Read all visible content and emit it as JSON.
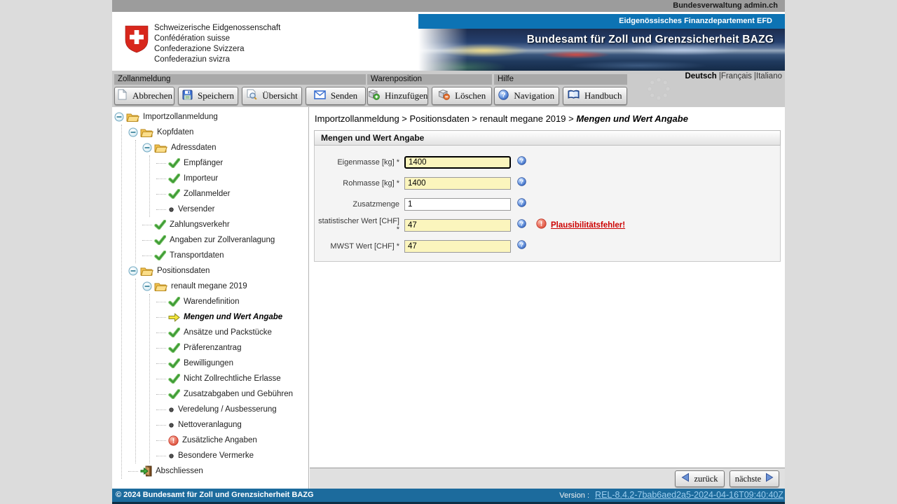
{
  "colors": {
    "accent_blue": "#0d73b4",
    "footer_blue": "#1c6b9d",
    "required_yellow": "#fbf5bd",
    "error_red": "#cc0000",
    "check_green": "#3d9b35",
    "swiss_red": "#d8271c"
  },
  "top_bar": {
    "text": "Bundesverwaltung admin.ch"
  },
  "header": {
    "logo_lines": [
      "Schweizerische Eidgenossenschaft",
      "Confédération suisse",
      "Confederazione Svizzera",
      "Confederaziun svizra"
    ],
    "department_bar": "Eidgenössisches Finanzdepartement EFD",
    "office_title": "Bundesamt für Zoll und Grenzsicherheit BAZG"
  },
  "languages": {
    "current": "Deutsch",
    "others": [
      "|Français",
      "|Italiano"
    ]
  },
  "toolbar": {
    "groups": [
      {
        "label": "Zollanmeldung",
        "buttons": [
          {
            "name": "cancel-button",
            "icon": "blank-page-icon",
            "label": "Abbrechen"
          },
          {
            "name": "save-button",
            "icon": "save-icon",
            "label": "Speichern"
          },
          {
            "name": "overview-button",
            "icon": "overview-icon",
            "label": "Übersicht"
          },
          {
            "name": "send-button",
            "icon": "send-icon",
            "label": "Senden"
          }
        ]
      },
      {
        "label": "Warenposition",
        "buttons": [
          {
            "name": "add-position-button",
            "icon": "package-add-icon",
            "label": "Hinzufügen"
          },
          {
            "name": "delete-position-button",
            "icon": "package-remove-icon",
            "label": "Löschen"
          }
        ]
      },
      {
        "label": "Hilfe",
        "buttons": [
          {
            "name": "navigation-button",
            "icon": "navigation-help-icon",
            "label": "Navigation"
          },
          {
            "name": "handbook-button",
            "icon": "handbook-icon",
            "label": "Handbuch"
          }
        ]
      }
    ]
  },
  "tree": {
    "items": [
      {
        "level": 0,
        "type": "branch",
        "label": "Importzollanmeldung"
      },
      {
        "level": 1,
        "type": "branch",
        "label": "Kopfdaten"
      },
      {
        "level": 2,
        "type": "branch",
        "label": "Adressdaten"
      },
      {
        "level": 3,
        "type": "leaf",
        "icon": "check-icon",
        "label": "Empfänger"
      },
      {
        "level": 3,
        "type": "leaf",
        "icon": "check-icon",
        "label": "Importeur"
      },
      {
        "level": 3,
        "type": "leaf",
        "icon": "check-icon",
        "label": "Zollanmelder"
      },
      {
        "level": 3,
        "type": "leaf",
        "icon": "bullet-icon",
        "label": "Versender"
      },
      {
        "level": 2,
        "type": "leaf",
        "icon": "check-icon",
        "label": "Zahlungsverkehr"
      },
      {
        "level": 2,
        "type": "leaf",
        "icon": "check-icon",
        "label": "Angaben zur Zollveranlagung"
      },
      {
        "level": 2,
        "type": "leaf",
        "icon": "check-icon",
        "label": "Transportdaten"
      },
      {
        "level": 1,
        "type": "branch",
        "label": "Positionsdaten"
      },
      {
        "level": 2,
        "type": "branch",
        "label": "renault megane 2019"
      },
      {
        "level": 3,
        "type": "leaf",
        "icon": "check-icon",
        "label": "Warendefinition"
      },
      {
        "level": 3,
        "type": "leaf",
        "icon": "current-arrow-icon",
        "label": "Mengen und Wert Angabe",
        "current": true
      },
      {
        "level": 3,
        "type": "leaf",
        "icon": "check-icon",
        "label": "Ansätze und Packstücke"
      },
      {
        "level": 3,
        "type": "leaf",
        "icon": "check-icon",
        "label": "Präferenzantrag"
      },
      {
        "level": 3,
        "type": "leaf",
        "icon": "check-icon",
        "label": "Bewilligungen"
      },
      {
        "level": 3,
        "type": "leaf",
        "icon": "check-icon",
        "label": "Nicht Zollrechtliche Erlasse"
      },
      {
        "level": 3,
        "type": "leaf",
        "icon": "check-icon",
        "label": "Zusatzabgaben und Gebühren"
      },
      {
        "level": 3,
        "type": "leaf",
        "icon": "bullet-icon",
        "label": "Veredelung / Ausbesserung"
      },
      {
        "level": 3,
        "type": "leaf",
        "icon": "bullet-icon",
        "label": "Nettoveranlagung"
      },
      {
        "level": 3,
        "type": "leaf",
        "icon": "error-icon",
        "label": "Zusätzliche Angaben"
      },
      {
        "level": 3,
        "type": "leaf",
        "icon": "bullet-icon",
        "label": "Besondere Vermerke"
      },
      {
        "level": 1,
        "type": "leaf",
        "icon": "exit-icon",
        "label": "Abschliessen"
      }
    ]
  },
  "main": {
    "breadcrumb": {
      "parts": [
        "Importzollanmeldung",
        "Positionsdaten",
        "renault megane 2019"
      ],
      "separator": " > ",
      "current": "Mengen und Wert Angabe"
    },
    "panel_title": "Mengen und Wert Angabe",
    "fields": [
      {
        "name": "eigenmasse-input",
        "label": "Eigenmasse [kg] *",
        "value": "1400",
        "required": true,
        "focused": true
      },
      {
        "name": "rohmasse-input",
        "label": "Rohmasse [kg] *",
        "value": "1400",
        "required": true
      },
      {
        "name": "zusatzmenge-input",
        "label": "Zusatzmenge",
        "value": "1",
        "required": false
      },
      {
        "name": "statistischer-wert-input",
        "label": "statistischer Wert [CHF] *",
        "value": "47",
        "required": true,
        "error": "Plausibilitätsfehler!"
      },
      {
        "name": "mwst-wert-input",
        "label": "MWST Wert [CHF] *",
        "value": "47",
        "required": true
      }
    ],
    "nav_buttons": {
      "back": "zurück",
      "next": "nächste"
    }
  },
  "footer": {
    "copyright": "© 2024 Bundesamt für Zoll und Grenzsicherheit BAZG",
    "version_label": "Version :",
    "version_link": "REL-8.4.2-7bab6aed2a5-2024-04-16T09:40:40Z"
  }
}
